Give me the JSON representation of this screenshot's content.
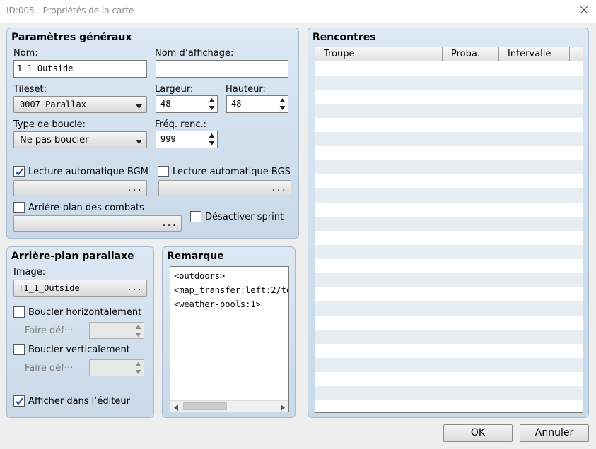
{
  "window": {
    "title": "ID:005 - Propriétés de la carte"
  },
  "general": {
    "title": "Paramètres généraux",
    "name_label": "Nom:",
    "name_value": "1_1_Outside",
    "display_name_label": "Nom d’affichage:",
    "display_name_value": "",
    "tileset_label": "Tileset:",
    "tileset_value": "0007 Parallax",
    "width_label": "Largeur:",
    "width_value": "48",
    "height_label": "Hauteur:",
    "height_value": "48",
    "loop_label": "Type de boucle:",
    "loop_value": "Ne pas boucler",
    "encounter_freq_label": "Fréq. renc.:",
    "encounter_freq_value": "999",
    "autoplay_bgm_label": "Lecture automatique BGM",
    "autoplay_bgm_checked": true,
    "autoplay_bgs_label": "Lecture automatique BGS",
    "autoplay_bgs_checked": false,
    "battleback_label": "Arrière-plan des combats",
    "battleback_checked": false,
    "disable_dash_label": "Désactiver sprint",
    "disable_dash_checked": false,
    "browse_glyph": "..."
  },
  "parallax": {
    "title": "Arrière-plan parallaxe",
    "image_label": "Image:",
    "image_value": "!1_1_Outside",
    "loop_h_label": "Boucler horizontalement",
    "loop_v_label": "Boucler verticalement",
    "scroll_label": "Faire déf···",
    "show_editor_label": "Afficher dans l’éditeur",
    "show_editor_checked": true
  },
  "note": {
    "title": "Remarque",
    "lines": [
      "<outdoors>",
      "<map_transfer:left:2/to",
      "<weather-pools:1>"
    ]
  },
  "encounters": {
    "title": "Rencontres",
    "columns": [
      "Troupe",
      "Proba.",
      "Intervalle"
    ]
  },
  "buttons": {
    "ok": "OK",
    "cancel": "Annuler"
  }
}
